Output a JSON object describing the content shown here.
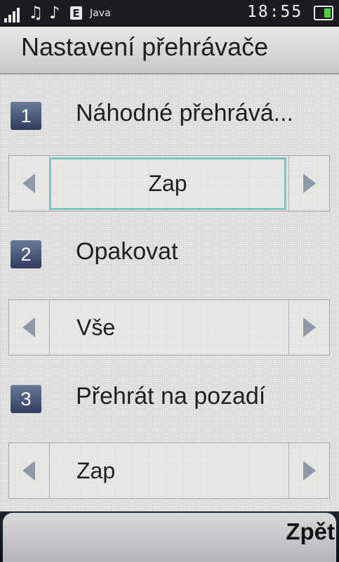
{
  "status_bar": {
    "network_type": "E",
    "java_label": "Java",
    "time": "18:55",
    "colors": {
      "battery": "#4fd04a"
    }
  },
  "title": "Nastavení přehrávače",
  "settings": [
    {
      "number": "1",
      "label": "Náhodné přehrává...",
      "value": "Zap",
      "focused": true
    },
    {
      "number": "2",
      "label": "Opakovat",
      "value": "Vše",
      "focused": false
    },
    {
      "number": "3",
      "label": "Přehrát na pozadí",
      "value": "Zap",
      "focused": false
    }
  ],
  "softkeys": {
    "right": "Zpět"
  },
  "accent_colors": {
    "focus_border": "#7fc3c3",
    "number_badge": "#3d4a70"
  }
}
